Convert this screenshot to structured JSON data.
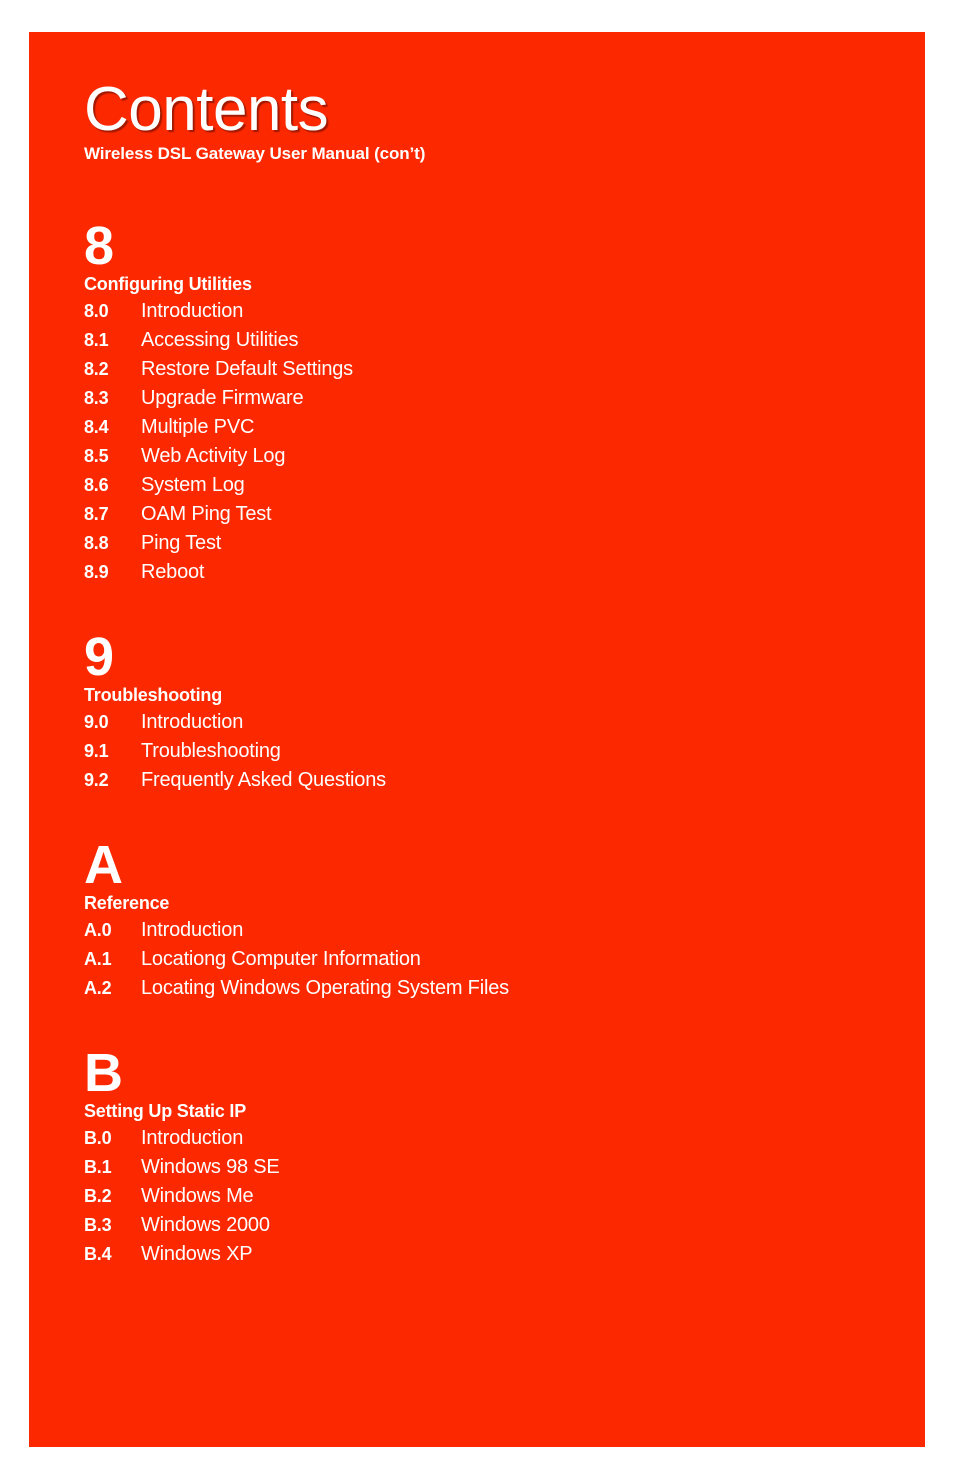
{
  "page": {
    "background_color": "#ffffff",
    "panel_color": "#fb2800",
    "text_color": "#ffffff"
  },
  "header": {
    "title": "Contents",
    "subtitle": "Wireless DSL Gateway User Manual (con’t)"
  },
  "toc": {
    "sections": [
      {
        "number": "8",
        "name": "Configuring Utilities",
        "entries": [
          {
            "num": "8.0",
            "label": "Introduction"
          },
          {
            "num": "8.1",
            "label": "Accessing Utilities"
          },
          {
            "num": "8.2",
            "label": "Restore Default Settings"
          },
          {
            "num": "8.3",
            "label": "Upgrade Firmware"
          },
          {
            "num": "8.4",
            "label": "Multiple PVC"
          },
          {
            "num": "8.5",
            "label": "Web Activity Log"
          },
          {
            "num": "8.6",
            "label": "System Log"
          },
          {
            "num": "8.7",
            "label": "OAM Ping Test"
          },
          {
            "num": "8.8",
            "label": "Ping Test"
          },
          {
            "num": "8.9",
            "label": "Reboot"
          }
        ]
      },
      {
        "number": "9",
        "name": "Troubleshooting",
        "entries": [
          {
            "num": "9.0",
            "label": "Introduction"
          },
          {
            "num": "9.1",
            "label": "Troubleshooting"
          },
          {
            "num": "9.2",
            "label": "Frequently Asked Questions"
          }
        ]
      },
      {
        "number": "A",
        "name": "Reference",
        "entries": [
          {
            "num": "A.0",
            "label": "Introduction"
          },
          {
            "num": "A.1",
            "label": "Locationg Computer Information"
          },
          {
            "num": "A.2",
            "label": "Locating Windows Operating System Files"
          }
        ]
      },
      {
        "number": "B",
        "name": "Setting Up Static IP",
        "entries": [
          {
            "num": "B.0",
            "label": "Introduction"
          },
          {
            "num": "B.1",
            "label": "Windows 98 SE"
          },
          {
            "num": "B.2",
            "label": "Windows Me"
          },
          {
            "num": "B.3",
            "label": "Windows 2000"
          },
          {
            "num": "B.4",
            "label": "Windows XP"
          }
        ]
      }
    ]
  }
}
